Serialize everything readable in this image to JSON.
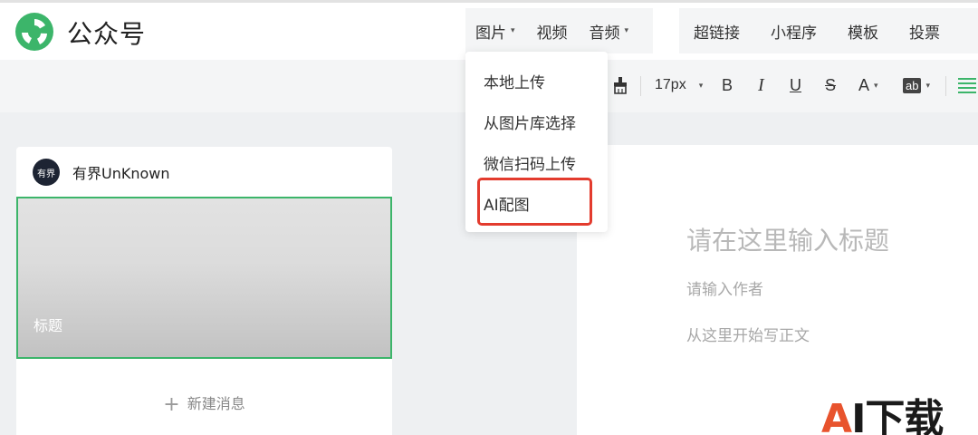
{
  "header": {
    "brand": "公众号",
    "nav_group1": [
      {
        "label": "图片",
        "has_caret": true
      },
      {
        "label": "视频",
        "has_caret": false
      },
      {
        "label": "音频",
        "has_caret": true
      }
    ],
    "nav_group2": [
      {
        "label": "超链接"
      },
      {
        "label": "小程序"
      },
      {
        "label": "模板"
      },
      {
        "label": "投票"
      }
    ]
  },
  "toolbar": {
    "font_size": "17px",
    "bold": "B",
    "italic": "I",
    "underline": "U",
    "strike": "S",
    "font_color": "A",
    "bg_color": "ab"
  },
  "account": {
    "avatar_text": "有界",
    "name": "有界UnKnown"
  },
  "article": {
    "cover_title": "标题",
    "new_message": "新建消息"
  },
  "editor": {
    "title_placeholder": "请在这里输入标题",
    "author_placeholder": "请输入作者",
    "body_placeholder": "从这里开始写正文"
  },
  "image_menu": {
    "items": [
      "本地上传",
      "从图片库选择",
      "微信扫码上传",
      "AI配图"
    ],
    "highlighted_index": 3
  },
  "watermark": {
    "a": "A",
    "rest": "I下载"
  },
  "colors": {
    "brand_green": "#3cb56a",
    "highlight_red": "#e33b2e"
  }
}
